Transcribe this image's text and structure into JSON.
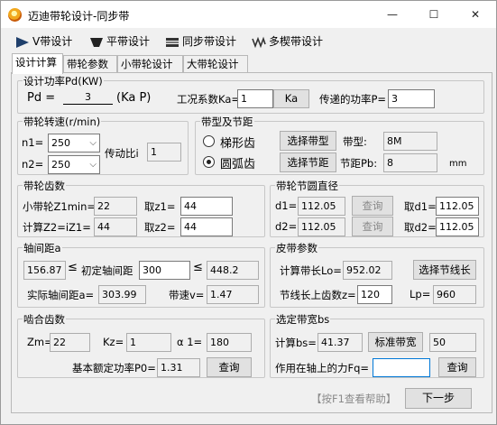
{
  "window": {
    "title": "迈迪带轮设计-同步带",
    "minimize": "—",
    "maximize": "☐",
    "close": "✕"
  },
  "menu": {
    "v_belt": "V带设计",
    "flat_belt": "平带设计",
    "sync_belt": "同步带设计",
    "multi_v": "多楔带设计"
  },
  "tabs": [
    "设计计算",
    "带轮参数",
    "小带轮设计",
    "大带轮设计"
  ],
  "power": {
    "group_label": "设计功率Pd(KW)",
    "formula_pd": "Pd =",
    "formula_value": "3",
    "formula_rest": "(Ka P)",
    "ka_label": "工况系数Ka=",
    "ka_value": "1",
    "ka_button": "Ka",
    "p_label": "传递的功率P=",
    "p_value": "3"
  },
  "speed": {
    "group_label": "带轮转速(r/min)",
    "n1_label": "n1=",
    "n1_value": "250",
    "n2_label": "n2=",
    "n2_value": "250",
    "ratio_label": "传动比i",
    "ratio_value": "1"
  },
  "belt_type": {
    "group_label": "带型及节距",
    "trap_label": "梯形齿",
    "arc_label": "圆弧齿",
    "select_type_btn": "选择带型",
    "type_label": "带型:",
    "type_value": "8M",
    "select_pitch_btn": "选择节距",
    "pitch_label": "节距Pb:",
    "pitch_value": "8",
    "pitch_unit": "mm"
  },
  "teeth": {
    "group_label": "带轮齿数",
    "z1min_label": "小带轮Z1min=",
    "z1min_value": "22",
    "z1_label": "取z1=",
    "z1_value": "44",
    "z2calc_label": "计算Z2=iZ1=",
    "z2calc_value": "44",
    "z2_label": "取z2=",
    "z2_value": "44"
  },
  "pitch_dia": {
    "group_label": "带轮节圆直径",
    "d1_label": "d1=",
    "d1_value": "112.05",
    "query1": "查询",
    "td1_label": "取d1=",
    "td1_value": "112.05",
    "d2_label": "d2=",
    "d2_value": "112.05",
    "query2": "查询",
    "td2_label": "取d2=",
    "td2_value": "112.05"
  },
  "center": {
    "group_label": "轴间距a",
    "min_value": "156.87",
    "le1": "≤",
    "init_label": "初定轴间距",
    "init_value": "300",
    "le2": "≤",
    "max_value": "448.2",
    "actual_label": "实际轴间距a=",
    "actual_value": "303.99",
    "speed_label": "带速v=",
    "speed_value": "1.47"
  },
  "belt_params": {
    "group_label": "皮带参数",
    "len_label": "计算带长Lo=",
    "len_value": "952.02",
    "select_len_btn": "选择节线长",
    "teeth_label": "节线长上齿数z=",
    "teeth_value": "120",
    "lp_label": "Lp=",
    "lp_value": "960"
  },
  "mesh": {
    "group_label": "啮合齿数",
    "zm_label": "Zm=",
    "zm_value": "22",
    "kz_label": "Kz=",
    "kz_value": "1",
    "alpha_label": "α 1=",
    "alpha_value": "180",
    "p0_label": "基本额定功率P0=",
    "p0_value": "1.31",
    "query": "查询"
  },
  "width": {
    "group_label": "选定带宽bs",
    "calc_label": "计算bs=",
    "calc_value": "41.37",
    "std_btn": "标准带宽",
    "std_value": "50",
    "force_label": "作用在轴上的力Fq=",
    "force_value": "",
    "query": "查询"
  },
  "footer": {
    "help": "【按F1查看帮助】",
    "next": "下一步"
  },
  "colors": {
    "accent": "#0078d7",
    "window_bg": "#f0f0f0"
  }
}
